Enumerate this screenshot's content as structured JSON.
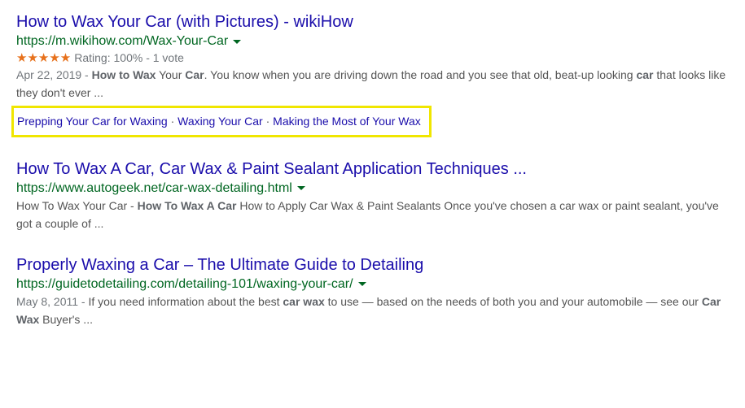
{
  "results": [
    {
      "title": "How to Wax Your Car (with Pictures) - wikiHow",
      "url": "https://m.wikihow.com/Wax-Your-Car",
      "rating": {
        "stars": "★★★★★",
        "text": "Rating: 100% - 1 vote"
      },
      "date": "Apr 22, 2019 - ",
      "snippet_pre_b1": "",
      "b1": "How to Wax",
      "snippet_mid1": " Your ",
      "b2": "Car",
      "snippet_mid2": ". You know when you are driving down the road and you see that old, beat-up looking ",
      "b3": "car",
      "snippet_post": " that looks like they don't ever ...",
      "sitelinks": [
        "Prepping Your Car for Waxing",
        "Waxing Your Car",
        "Making the Most of Your Wax"
      ]
    },
    {
      "title": "How To Wax A Car, Car Wax & Paint Sealant Application Techniques ...",
      "url": "https://www.autogeek.net/car-wax-detailing.html",
      "date": "",
      "snippet_pre_b1": "How To Wax Your Car - ",
      "b1": "How To Wax A Car",
      "snippet_mid1": " How to Apply Car Wax & Paint Sealants Once you've chosen a car wax or paint sealant, you've got a couple of ...",
      "b2": "",
      "snippet_mid2": "",
      "b3": "",
      "snippet_post": ""
    },
    {
      "title": "Properly Waxing a Car – The Ultimate Guide to Detailing",
      "url": "https://guidetodetailing.com/detailing-101/waxing-your-car/",
      "date": "May 8, 2011 - ",
      "snippet_pre_b1": "If you need information about the best ",
      "b1": "car wax",
      "snippet_mid1": " to use — based on the needs of both you and your automobile — see our ",
      "b2": "Car Wax",
      "snippet_mid2": " Buyer's ...",
      "b3": "",
      "snippet_post": ""
    }
  ],
  "sep": " · "
}
